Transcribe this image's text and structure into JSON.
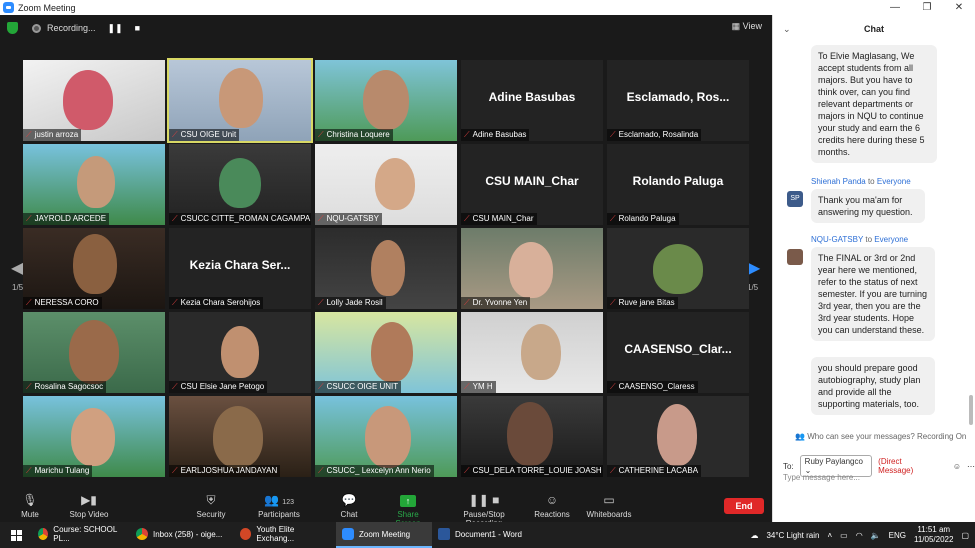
{
  "window": {
    "title": "Zoom Meeting",
    "controls": [
      "—",
      "❐",
      "✕"
    ]
  },
  "recording": {
    "label": "Recording...",
    "pause": "❚❚",
    "stop": "■"
  },
  "view_label": "View",
  "pager": {
    "left": "1/5",
    "right": "1/5"
  },
  "tiles": [
    {
      "name": "justin arroza",
      "big": ""
    },
    {
      "name": "CSU OIGE Unit",
      "big": ""
    },
    {
      "name": "Christina Loquere",
      "big": ""
    },
    {
      "name": "Adine Basubas",
      "big": "Adine Basubas"
    },
    {
      "name": "Esclamado, Rosalinda",
      "big": "Esclamado, Ros..."
    },
    {
      "name": "JAYROLD ARCEDE",
      "big": ""
    },
    {
      "name": "CSUCC CITTE_ROMAN CAGAMPA...",
      "big": ""
    },
    {
      "name": "NQU-GATSBY",
      "big": ""
    },
    {
      "name": "CSU MAIN_Char",
      "big": "CSU MAIN_Char"
    },
    {
      "name": "Rolando Paluga",
      "big": "Rolando Paluga"
    },
    {
      "name": "NERESSA CORO",
      "big": ""
    },
    {
      "name": "Kezia Chara Serohijos",
      "big": "Kezia Chara Ser..."
    },
    {
      "name": "Lolly Jade Rosil",
      "big": ""
    },
    {
      "name": "Dr. Yvonne Yen",
      "big": ""
    },
    {
      "name": "Ruve jane Bitas",
      "big": ""
    },
    {
      "name": "Rosalina Sagocsoc",
      "big": ""
    },
    {
      "name": "CSU Elsie Jane Petogo",
      "big": ""
    },
    {
      "name": "CSUCC OIGE UNIT",
      "big": ""
    },
    {
      "name": "YM H",
      "big": ""
    },
    {
      "name": "CAASENSO_Claress",
      "big": "CAASENSO_Clar..."
    },
    {
      "name": "Marichu Tulang",
      "big": ""
    },
    {
      "name": "EARLJOSHUA JANDAYAN",
      "big": ""
    },
    {
      "name": "CSUCC_ Lexcelyn Ann Nerio",
      "big": ""
    },
    {
      "name": "CSU_DELA TORRE_LOUIE JOASH",
      "big": ""
    },
    {
      "name": "CATHERINE LACABA",
      "big": ""
    }
  ],
  "toolbar": {
    "mute": "Mute",
    "video": "Stop Video",
    "security": "Security",
    "participants": "Participants",
    "participants_count": "123",
    "chat": "Chat",
    "share": "Share Screen",
    "record": "Pause/Stop Recording",
    "reactions": "Reactions",
    "whiteboards": "Whiteboards",
    "end": "End"
  },
  "chat": {
    "title": "Chat",
    "msg1": "To Elvie Maglasang,  We accept students from all majors. But you have to think over, can you find relevant departments or majors in NQU to continue your study and earn the 6 credits here during these 5 months.",
    "sender2": "Shienah Panda",
    "to_word": "to",
    "everyone": "Everyone",
    "avatar2": "SP",
    "msg2": "Thank you ma'am for answering my question.",
    "sender3": "NQU-GATSBY",
    "msg3": "The FINAL or 3rd or 2nd year here we mentioned, refer to the status of next semester. If you are turning 3rd year, then you are the 3rd year students. Hope you can understand these.",
    "msg4": "you should prepare good autobiography, study plan and provide all the supporting materials, too.",
    "who_can_see": "Who can see your messages? Recording On",
    "to_label": "To:",
    "recipient": "Ruby Paylangco",
    "direct": "(Direct Message)",
    "placeholder": "Type message here..."
  },
  "taskbar": {
    "items": [
      "Course: SCHOOL PL...",
      "Inbox (258) - oige...",
      "Youth Elite Exchang...",
      "Zoom Meeting",
      "Document1 - Word"
    ],
    "weather": "34°C  Light rain",
    "lang": "ENG",
    "time": "11:51 am",
    "date": "11/05/2022"
  },
  "colors": {
    "accent": "#2d8cff",
    "share_green": "#23a638",
    "end_red": "#e02828",
    "active_speaker": "#d8d865"
  }
}
